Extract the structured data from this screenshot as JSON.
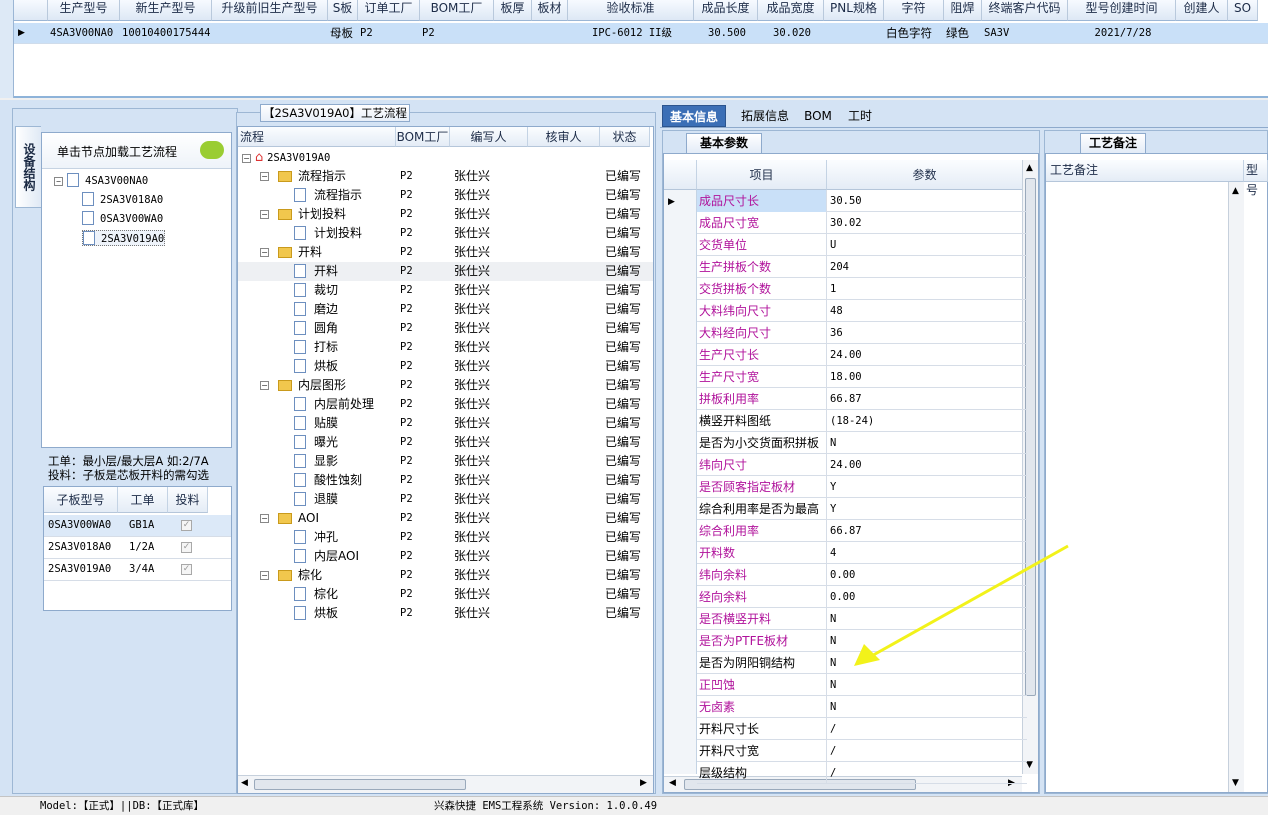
{
  "top_grid": {
    "headers": [
      "生产型号",
      "新生产型号",
      "升级前旧生产型号",
      "S板",
      "订单工厂",
      "BOM工厂",
      "板厚",
      "板材",
      "验收标准",
      "成品长度",
      "成品宽度",
      "PNL规格",
      "字符",
      "阻焊",
      "终端客户代码",
      "型号创建时间",
      "创建人",
      "SO"
    ],
    "row": [
      "4SA3V00NA0",
      "10010400175444",
      "",
      "母板",
      "P2",
      "P2",
      "",
      "",
      "IPC-6012 II级",
      "30.500",
      "30.020",
      "",
      "白色字符",
      "绿色",
      "SA3V",
      "2021/7/28",
      "",
      ""
    ]
  },
  "left": {
    "vertical_tab": "设备结构",
    "hint": "单击节点加载工艺流程",
    "tree_root": "4SA3V00NA0",
    "tree_children": [
      "2SA3V018A0",
      "0SA3V00WA0",
      "2SA3V019A0"
    ],
    "info1": "工单：最小层/最大层A 如:2/7A",
    "info2": "投料：子板是芯板开料的需勾选",
    "sub_headers": [
      "子板型号",
      "工单",
      "投料"
    ],
    "sub_rows": [
      [
        "0SA3V00WA0",
        "GB1A"
      ],
      [
        "2SA3V018A0",
        "1/2A"
      ],
      [
        "2SA3V019A0",
        "3/4A"
      ]
    ]
  },
  "flow": {
    "title": "【2SA3V019A0】工艺流程",
    "headers": [
      "流程",
      "BOM工厂",
      "编写人",
      "核审人",
      "状态"
    ],
    "root": "2SA3V019A0",
    "rows": [
      {
        "name": "流程指示",
        "folder": true,
        "bom": "P2",
        "writer": "张仕兴",
        "status": "已编写"
      },
      {
        "name": "流程指示",
        "folder": false,
        "bom": "P2",
        "writer": "张仕兴",
        "status": "已编写"
      },
      {
        "name": "计划投料",
        "folder": true,
        "bom": "P2",
        "writer": "张仕兴",
        "status": "已编写"
      },
      {
        "name": "计划投料",
        "folder": false,
        "bom": "P2",
        "writer": "张仕兴",
        "status": "已编写"
      },
      {
        "name": "开料",
        "folder": true,
        "bom": "P2",
        "writer": "张仕兴",
        "status": "已编写"
      },
      {
        "name": "开料",
        "folder": false,
        "bom": "P2",
        "writer": "张仕兴",
        "status": "已编写"
      },
      {
        "name": "裁切",
        "folder": false,
        "bom": "P2",
        "writer": "张仕兴",
        "status": "已编写"
      },
      {
        "name": "磨边",
        "folder": false,
        "bom": "P2",
        "writer": "张仕兴",
        "status": "已编写"
      },
      {
        "name": "圆角",
        "folder": false,
        "bom": "P2",
        "writer": "张仕兴",
        "status": "已编写"
      },
      {
        "name": "打标",
        "folder": false,
        "bom": "P2",
        "writer": "张仕兴",
        "status": "已编写"
      },
      {
        "name": "烘板",
        "folder": false,
        "bom": "P2",
        "writer": "张仕兴",
        "status": "已编写"
      },
      {
        "name": "内层图形",
        "folder": true,
        "bom": "P2",
        "writer": "张仕兴",
        "status": "已编写"
      },
      {
        "name": "内层前处理",
        "folder": false,
        "bom": "P2",
        "writer": "张仕兴",
        "status": "已编写"
      },
      {
        "name": "贴膜",
        "folder": false,
        "bom": "P2",
        "writer": "张仕兴",
        "status": "已编写"
      },
      {
        "name": "曝光",
        "folder": false,
        "bom": "P2",
        "writer": "张仕兴",
        "status": "已编写"
      },
      {
        "name": "显影",
        "folder": false,
        "bom": "P2",
        "writer": "张仕兴",
        "status": "已编写"
      },
      {
        "name": "酸性蚀刻",
        "folder": false,
        "bom": "P2",
        "writer": "张仕兴",
        "status": "已编写"
      },
      {
        "name": "退膜",
        "folder": false,
        "bom": "P2",
        "writer": "张仕兴",
        "status": "已编写"
      },
      {
        "name": "AOI",
        "folder": true,
        "bom": "P2",
        "writer": "张仕兴",
        "status": "已编写"
      },
      {
        "name": "冲孔",
        "folder": false,
        "bom": "P2",
        "writer": "张仕兴",
        "status": "已编写"
      },
      {
        "name": "内层AOI",
        "folder": false,
        "bom": "P2",
        "writer": "张仕兴",
        "status": "已编写"
      },
      {
        "name": "棕化",
        "folder": true,
        "bom": "P2",
        "writer": "张仕兴",
        "status": "已编写"
      },
      {
        "name": "棕化",
        "folder": false,
        "bom": "P2",
        "writer": "张仕兴",
        "status": "已编写"
      },
      {
        "name": "烘板",
        "folder": false,
        "bom": "P2",
        "writer": "张仕兴",
        "status": "已编写"
      }
    ]
  },
  "tabs": [
    "基本信息",
    "拓展信息",
    "BOM",
    "工时"
  ],
  "params": {
    "subtab": "基本参数",
    "col_item": "项目",
    "col_value": "参数",
    "rows": [
      [
        "成品尺寸长",
        "30.50",
        true
      ],
      [
        "成品尺寸宽",
        "30.02",
        true
      ],
      [
        "交货单位",
        "U",
        true
      ],
      [
        "生产拼板个数",
        "204",
        true
      ],
      [
        "交货拼板个数",
        "1",
        true
      ],
      [
        "大料纬向尺寸",
        "48",
        true
      ],
      [
        "大料经向尺寸",
        "36",
        true
      ],
      [
        "生产尺寸长",
        "24.00",
        true
      ],
      [
        "生产尺寸宽",
        "18.00",
        true
      ],
      [
        "拼板利用率",
        "66.87",
        true
      ],
      [
        "横竖开料图纸",
        "(18-24)",
        false
      ],
      [
        "是否为小交货面积拼板",
        "N",
        false
      ],
      [
        "纬向尺寸",
        "24.00",
        true
      ],
      [
        "是否顾客指定板材",
        "Y",
        true
      ],
      [
        "综合利用率是否为最高",
        "Y",
        false
      ],
      [
        "综合利用率",
        "66.87",
        true
      ],
      [
        "开料数",
        "4",
        true
      ],
      [
        "纬向余料",
        "0.00",
        true
      ],
      [
        "经向余料",
        "0.00",
        true
      ],
      [
        "是否横竖开料",
        "N",
        true
      ],
      [
        "是否为PTFE板材",
        "N",
        true
      ],
      [
        "是否为阴阳铜结构",
        "N",
        false
      ],
      [
        "正凹蚀",
        "N",
        true
      ],
      [
        "无卤素",
        "N",
        true
      ],
      [
        "开料尺寸长",
        "/",
        false
      ],
      [
        "开料尺寸宽",
        "/",
        false
      ],
      [
        "层级结构",
        "/",
        false
      ]
    ]
  },
  "remark": {
    "tab": "工艺备注",
    "col1": "工艺备注",
    "col2": "型号"
  },
  "status": {
    "left": "Model:【正式】||DB:【正式库】",
    "center": "兴森快捷 EMS工程系统 Version: 1.0.0.49"
  },
  "colors": {
    "magenta": "#b0129b",
    "selected": "#c9e0f8",
    "arrow": "#f2f21a"
  }
}
